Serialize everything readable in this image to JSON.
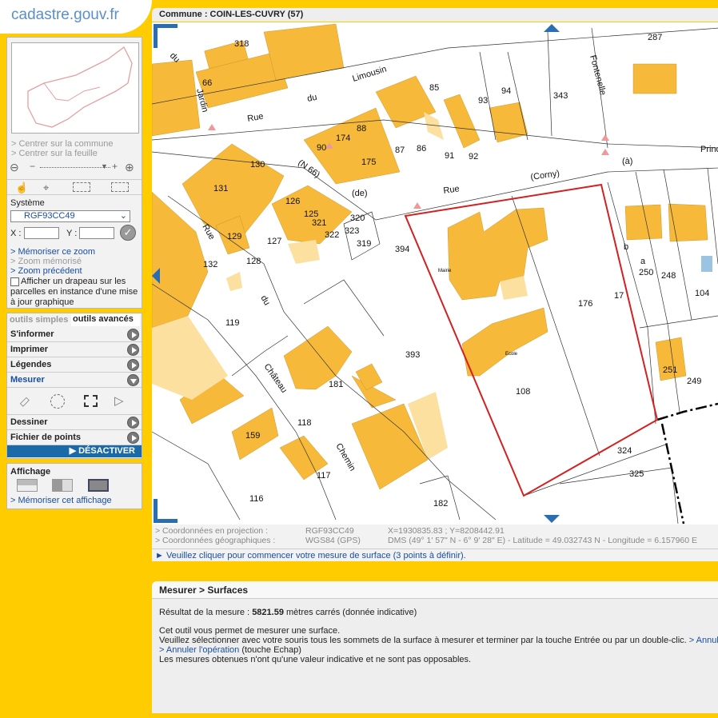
{
  "brand": "cadastre.gouv.fr",
  "title": "Commune : COIN-LES-CUVRY (57)",
  "sidebar": {
    "center_commune": "> Centrer sur la commune",
    "center_sheet": "> Centrer sur la feuille",
    "system_label": "Système",
    "system_value": "RGF93CC49",
    "x_label": "X :",
    "y_label": "Y :",
    "memorise_zoom": "> Mémoriser ce zoom",
    "zoom_memorised": "> Zoom mémorisé",
    "zoom_previous": "> Zoom précédent",
    "flag_text": "Afficher un drapeau sur les parcelles en instance d'une mise à jour graphique",
    "tabs": [
      "outils simples",
      "outils avancés"
    ],
    "tools": [
      "S'informer",
      "Imprimer",
      "Légendes",
      "Mesurer",
      "Dessiner",
      "Fichier de points"
    ],
    "deactivate": "DÉSACTIVER",
    "affichage_title": "Affichage",
    "memorise_display": "> Mémoriser cet affichage"
  },
  "map": {
    "streets": [
      "du",
      "Jardin",
      "Rue",
      "du",
      "Limousin",
      "(N 66)",
      "(de)",
      "Rue",
      "(Corny)",
      "(à)",
      "Princ",
      "Fontenelle",
      "Rue",
      "du",
      "Château",
      "Chemin",
      "b",
      "a"
    ],
    "parcels": [
      "318",
      "66",
      "85",
      "93",
      "94",
      "343",
      "287",
      "90",
      "174",
      "88",
      "87",
      "86",
      "91",
      "92",
      "175",
      "130",
      "131",
      "126",
      "125",
      "321",
      "320",
      "322",
      "323",
      "319",
      "129",
      "127",
      "128",
      "132",
      "394",
      "250",
      "248",
      "104",
      "176",
      "17",
      "119",
      "393",
      "251",
      "249",
      "181",
      "108",
      "118",
      "159",
      "324",
      "117",
      "325",
      "116",
      "182"
    ],
    "building_labels": [
      "Mairie",
      "Ecole"
    ]
  },
  "coords": {
    "proj_label": "> Coordonnées en projection :",
    "proj_system": "RGF93CC49",
    "proj_value": "X=1930835.83 ; Y=8208442.91",
    "geo_label": "> Coordonnées géographiques :",
    "geo_system": "WGS84 (GPS)",
    "geo_value": "DMS (49° 1' 57\" N - 6° 9' 28\" E) - Latitude = 49.032743 N - Longitude = 6.157960 E"
  },
  "message": "► Veuillez cliquer pour commencer votre mesure de surface (3 points à définir).",
  "panel": {
    "title": "Mesurer > Surfaces",
    "result_prefix": "Résultat de la mesure :",
    "result_value": "5821.59",
    "result_suffix": "mètres carrés (donnée indicative)",
    "line1": "Cet outil vous permet de mesurer une surface.",
    "line2": "Veuillez sélectionner avec votre souris tous les sommets de la surface à mesurer et terminer par la touche Entrée ou par un double-clic.",
    "line2_link": "> Annul",
    "cancel_link": "> Annuler l'opération",
    "cancel_suffix": "(touche Echap)",
    "line4": "Les mesures obtenues n'ont qu'une valeur indicative et ne sont pas opposables."
  },
  "colors": {
    "background": "#ffcc00",
    "building": "#f7b93a",
    "building_light": "#fbe0a0",
    "selection": "#d42020",
    "link": "#1a4ea0"
  }
}
